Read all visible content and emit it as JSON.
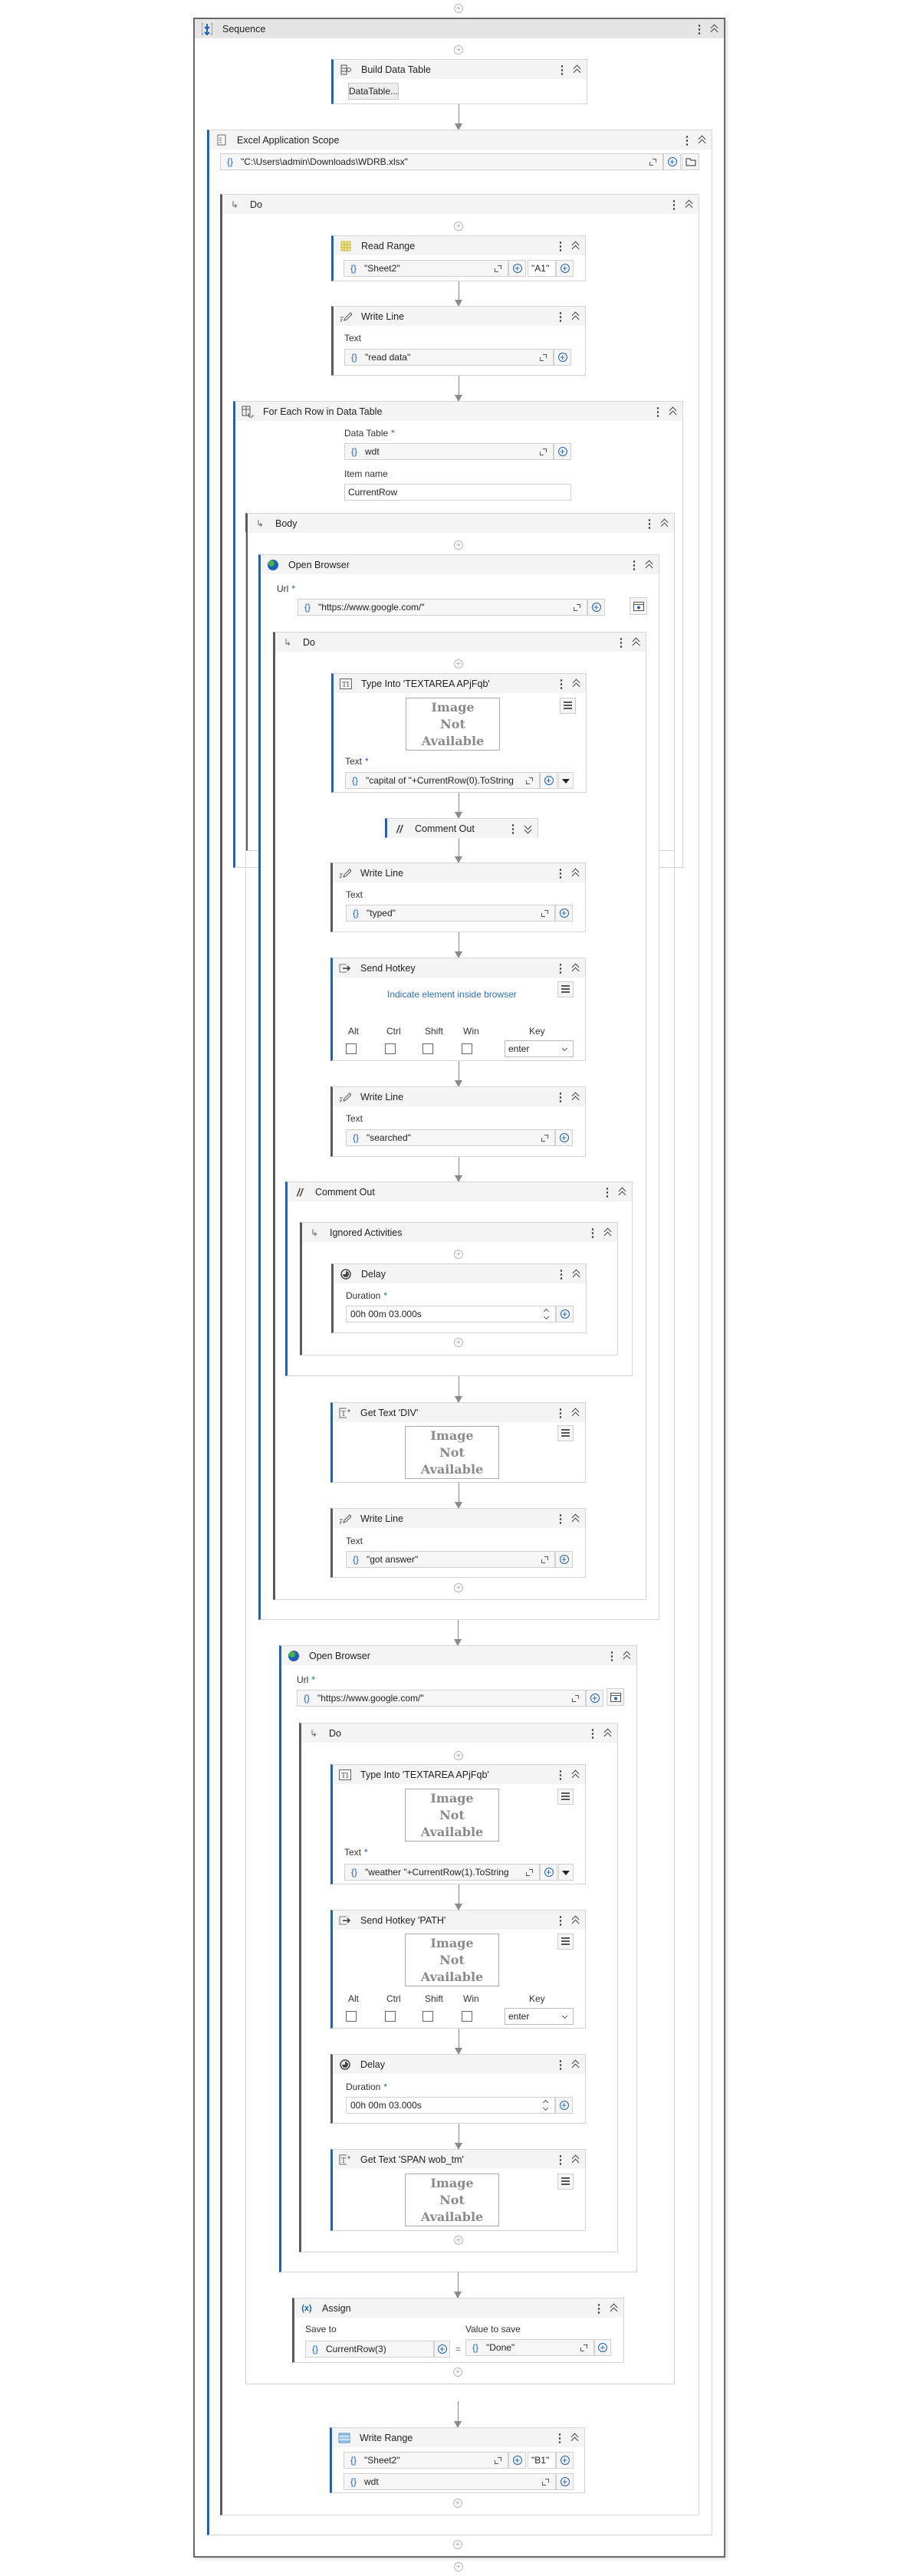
{
  "sequence": {
    "title": "Sequence"
  },
  "build_data_table": {
    "title": "Build Data Table",
    "button": "DataTable..."
  },
  "excel_scope": {
    "title": "Excel Application Scope",
    "path": "\"C:\\Users\\admin\\Downloads\\WDRB.xlsx\""
  },
  "excel_do": {
    "title": "Do"
  },
  "read_range": {
    "title": "Read Range",
    "sheet": "\"Sheet2\"",
    "range": "\"A1\""
  },
  "write_line_1": {
    "title": "Write Line",
    "label": "Text",
    "value": "\"read data\""
  },
  "for_each": {
    "title": "For Each Row in Data Table",
    "data_table_label": "Data Table",
    "required": "*",
    "data_table": "wdt",
    "item_label": "Item name",
    "item": "CurrentRow"
  },
  "body": {
    "title": "Body"
  },
  "open_browser_1": {
    "title": "Open Browser",
    "url_label": "Url",
    "url": "\"https://www.google.com/\""
  },
  "do_1": {
    "title": "Do"
  },
  "type_into_1": {
    "title": "Type Into 'TEXTAREA  APjFqb'",
    "image_placeholder": "Image Not Available",
    "text_label": "Text",
    "text": "\"capital of \"+CurrentRow(0).ToString"
  },
  "comment_out_collapsed": {
    "title": "Comment Out"
  },
  "write_line_2": {
    "title": "Write Line",
    "label": "Text",
    "value": "\"typed\""
  },
  "send_hotkey": {
    "title": "Send Hotkey",
    "indicate": "Indicate element inside browser",
    "modifiers": [
      {
        "label": "Alt",
        "checked": false
      },
      {
        "label": "Ctrl",
        "checked": false
      },
      {
        "label": "Shift",
        "checked": false
      },
      {
        "label": "Win",
        "checked": false
      }
    ],
    "key_label": "Key",
    "key": "enter"
  },
  "write_line_3": {
    "title": "Write Line",
    "label": "Text",
    "value": "\"searched\""
  },
  "comment_out": {
    "title": "Comment Out"
  },
  "ignored_activities": {
    "title": "Ignored Activities"
  },
  "delay_1": {
    "title": "Delay",
    "label": "Duration",
    "value": "00h 00m 03.000s"
  },
  "get_text_div": {
    "title": "Get Text 'DIV'",
    "image_placeholder": "Image Not Available"
  },
  "write_line_4": {
    "title": "Write Line",
    "label": "Text",
    "value": "\"got answer\""
  },
  "open_browser_2": {
    "title": "Open Browser",
    "url_label": "Url",
    "url": "\"https://www.google.com/\""
  },
  "do_2": {
    "title": "Do"
  },
  "type_into_2": {
    "title": "Type Into 'TEXTAREA  APjFqb'",
    "image_placeholder": "Image Not Available",
    "text_label": "Text",
    "text": "\"weather \"+CurrentRow(1).ToString"
  },
  "send_hotkey_path": {
    "title": "Send Hotkey 'PATH'",
    "image_placeholder": "Image Not Available",
    "modifiers": [
      {
        "label": "Alt",
        "checked": false
      },
      {
        "label": "Ctrl",
        "checked": false
      },
      {
        "label": "Shift",
        "checked": false
      },
      {
        "label": "Win",
        "checked": false
      }
    ],
    "key_label": "Key",
    "key": "enter"
  },
  "delay_2": {
    "title": "Delay",
    "label": "Duration",
    "value": "00h 00m 03.000s"
  },
  "get_text_span": {
    "title": "Get Text 'SPAN  wob_tm'",
    "image_placeholder": "Image Not Available"
  },
  "assign": {
    "title": "Assign",
    "save_to_label": "Save to",
    "save_to": "CurrentRow(3)",
    "equals": "=",
    "value_label": "Value to save",
    "value": "\"Done\""
  },
  "write_range": {
    "title": "Write Range",
    "sheet": "\"Sheet2\"",
    "range": "\"B1\"",
    "data": "wdt"
  },
  "colors": {
    "accent": "#1e62b4",
    "container_bar": "#5a5a5a",
    "header_bg": "#f4f4f4",
    "link": "#2f6fb0"
  }
}
